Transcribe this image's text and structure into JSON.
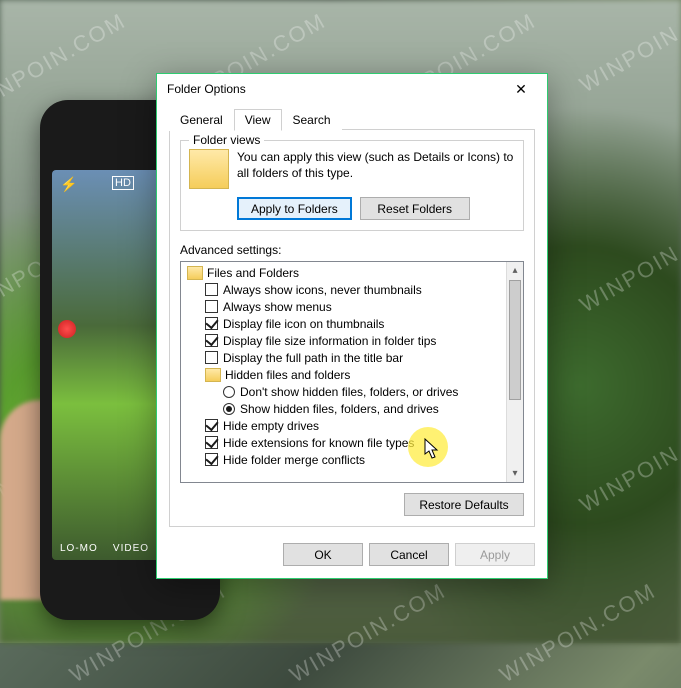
{
  "dialog": {
    "title": "Folder Options",
    "tabs": [
      "General",
      "View",
      "Search"
    ],
    "active_tab": 1,
    "folder_views": {
      "group_title": "Folder views",
      "description": "You can apply this view (such as Details or Icons) to all folders of this type.",
      "apply_btn": "Apply to Folders",
      "reset_btn": "Reset Folders"
    },
    "advanced_label": "Advanced settings:",
    "tree": {
      "root": "Files and Folders",
      "items": [
        {
          "type": "checkbox",
          "checked": false,
          "label": "Always show icons, never thumbnails"
        },
        {
          "type": "checkbox",
          "checked": false,
          "label": "Always show menus"
        },
        {
          "type": "checkbox",
          "checked": true,
          "label": "Display file icon on thumbnails"
        },
        {
          "type": "checkbox",
          "checked": true,
          "label": "Display file size information in folder tips"
        },
        {
          "type": "checkbox",
          "checked": false,
          "label": "Display the full path in the title bar"
        },
        {
          "type": "folder",
          "label": "Hidden files and folders"
        },
        {
          "type": "radio",
          "checked": false,
          "label": "Don't show hidden files, folders, or drives"
        },
        {
          "type": "radio",
          "checked": true,
          "label": "Show hidden files, folders, and drives"
        },
        {
          "type": "checkbox",
          "checked": true,
          "label": "Hide empty drives"
        },
        {
          "type": "checkbox",
          "checked": true,
          "label": "Hide extensions for known file types"
        },
        {
          "type": "checkbox",
          "checked": true,
          "label": "Hide folder merge conflicts"
        }
      ]
    },
    "restore_btn": "Restore Defaults",
    "ok_btn": "OK",
    "cancel_btn": "Cancel",
    "apply_btn": "Apply"
  },
  "watermark_text": "WINPOIN.COM",
  "phone": {
    "modes": [
      "LO-MO",
      "VIDEO"
    ]
  }
}
